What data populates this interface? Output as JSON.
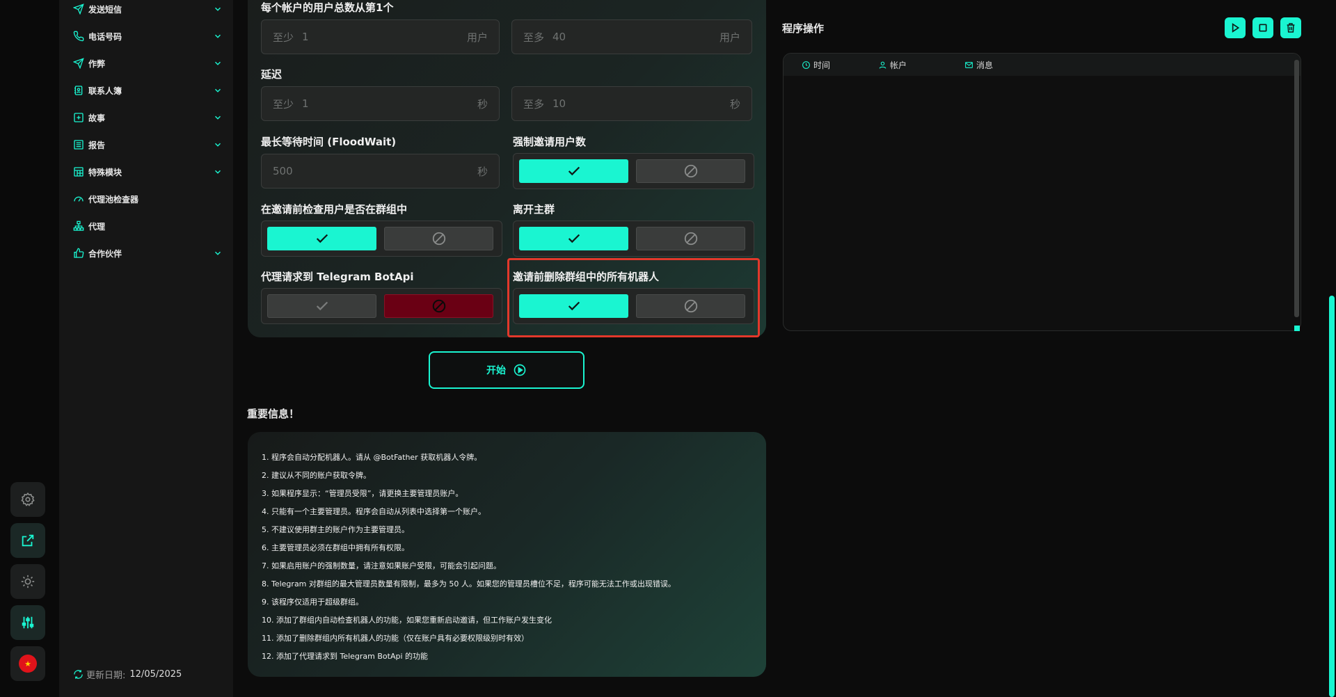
{
  "sidebar": {
    "items": [
      {
        "label": "发送短信",
        "icon": "send-icon",
        "has_chevron": true
      },
      {
        "label": "电话号码",
        "icon": "phone-icon",
        "has_chevron": true
      },
      {
        "label": "作弊",
        "icon": "send-icon",
        "has_chevron": true
      },
      {
        "label": "联系人簿",
        "icon": "contacts-icon",
        "has_chevron": true
      },
      {
        "label": "故事",
        "icon": "plus-square-icon",
        "has_chevron": true
      },
      {
        "label": "报告",
        "icon": "report-icon",
        "has_chevron": true
      },
      {
        "label": "特殊模块",
        "icon": "module-icon",
        "has_chevron": true
      },
      {
        "label": "代理池检查器",
        "icon": "gauge-icon",
        "has_chevron": false
      },
      {
        "label": "代理",
        "icon": "network-icon",
        "has_chevron": false
      },
      {
        "label": "合作伙伴",
        "icon": "thumbs-up-icon",
        "has_chevron": true
      }
    ],
    "update_label": "更新日期:",
    "update_date": "12/05/2025"
  },
  "form": {
    "users_per_account": {
      "label": "每个帐户的用户总数从第1个",
      "min": {
        "prefix": "至少",
        "value": "1",
        "unit": "用户"
      },
      "max": {
        "prefix": "至多",
        "value": "40",
        "unit": "用户"
      }
    },
    "delay": {
      "label": "延迟",
      "min": {
        "prefix": "至少",
        "value": "1",
        "unit": "秒"
      },
      "max": {
        "prefix": "至多",
        "value": "10",
        "unit": "秒"
      }
    },
    "floodwait": {
      "label": "最长等待时间 (FloodWait)",
      "value": "500",
      "unit": "秒"
    },
    "force_invite": {
      "label": "强制邀请用户数",
      "value": true
    },
    "check_in_group": {
      "label": "在邀请前检查用户是否在群组中",
      "value": true
    },
    "leave_main": {
      "label": "离开主群",
      "value": true
    },
    "proxy_botapi": {
      "label": "代理请求到 Telegram BotApi",
      "value": false
    },
    "remove_bots": {
      "label": "邀请前删除群组中的所有机器人",
      "value": true
    }
  },
  "start_button": {
    "label": "开始"
  },
  "important": {
    "title": "重要信息！",
    "items": [
      "1. 程序会自动分配机器人。请从 @BotFather 获取机器人令牌。",
      "2. 建议从不同的账户获取令牌。",
      "3. 如果程序显示：“管理员受限”，请更换主要管理员账户。",
      "4. 只能有一个主要管理员。程序会自动从列表中选择第一个账户。",
      "5. 不建议使用群主的账户作为主要管理员。",
      "6. 主要管理员必须在群组中拥有所有权限。",
      "7. 如果启用账户的强制数量，请注意如果账户受限，可能会引起问题。",
      "8. Telegram 对群组的最大管理员数量有限制，最多为 50 人。如果您的管理员槽位不足，程序可能无法工作或出现错误。",
      "9. 该程序仅适用于超级群组。",
      "10. 添加了群组内自动检查机器人的功能，如果您重新启动邀请，但工作账户发生变化",
      "11. 添加了删除群组内所有机器人的功能（仅在账户具有必要权限级别时有效）",
      "12. 添加了代理请求到 Telegram BotApi 的功能"
    ]
  },
  "program": {
    "title": "程序操作",
    "columns": [
      "时间",
      "帐户",
      "消息"
    ]
  },
  "colors": {
    "accent": "#1af5d1",
    "danger": "#6a0014",
    "highlight": "#e2382b"
  }
}
